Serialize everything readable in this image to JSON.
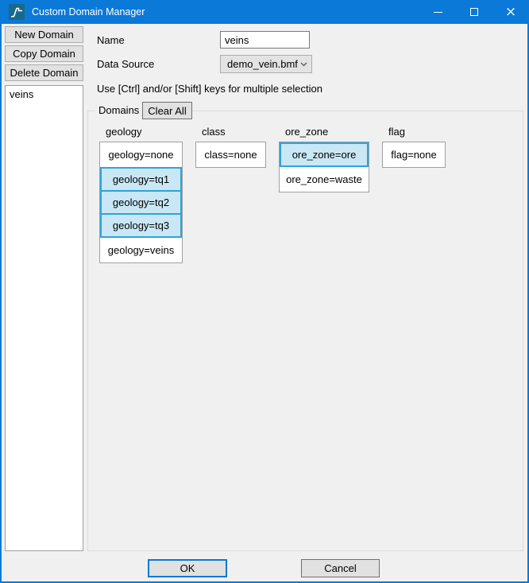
{
  "window": {
    "title": "Custom Domain Manager",
    "icon": "polyline-chart-icon",
    "controls": {
      "minimize": "minimize-icon",
      "maximize": "maximize-icon",
      "close_glyph": "×"
    }
  },
  "sidebar": {
    "buttons": [
      {
        "label": "New Domain"
      },
      {
        "label": "Copy Domain"
      },
      {
        "label": "Delete Domain"
      }
    ],
    "list": {
      "items": [
        {
          "label": "veins"
        }
      ]
    }
  },
  "form": {
    "name_label": "Name",
    "name_value": "veins",
    "data_source_label": "Data Source",
    "data_source_value": "demo_vein.bmf",
    "hint": "Use [Ctrl] and/or [Shift] keys for multiple selection"
  },
  "domains": {
    "group_label": "Domains",
    "clear_all_label": "Clear All",
    "columns": [
      {
        "header": "geology",
        "items": [
          {
            "label": "geology=none",
            "selected": false
          },
          {
            "label": "geology=tq1",
            "selected": true
          },
          {
            "label": "geology=tq2",
            "selected": true
          },
          {
            "label": "geology=tq3",
            "selected": true
          },
          {
            "label": "geology=veins",
            "selected": false
          }
        ]
      },
      {
        "header": "class",
        "items": [
          {
            "label": "class=none",
            "selected": false
          }
        ]
      },
      {
        "header": "ore_zone",
        "items": [
          {
            "label": "ore_zone=ore",
            "selected": true
          },
          {
            "label": "ore_zone=waste",
            "selected": false
          }
        ]
      },
      {
        "header": "flag",
        "items": [
          {
            "label": "flag=none",
            "selected": false
          }
        ]
      }
    ]
  },
  "footer": {
    "ok_label": "OK",
    "cancel_label": "Cancel"
  },
  "colors": {
    "titlebar": "#0b79d7",
    "accent": "#0b79d7",
    "selected_fill": "#c9e7f5",
    "selected_border": "#2ea3dc",
    "icon_teal": "#19698c"
  }
}
